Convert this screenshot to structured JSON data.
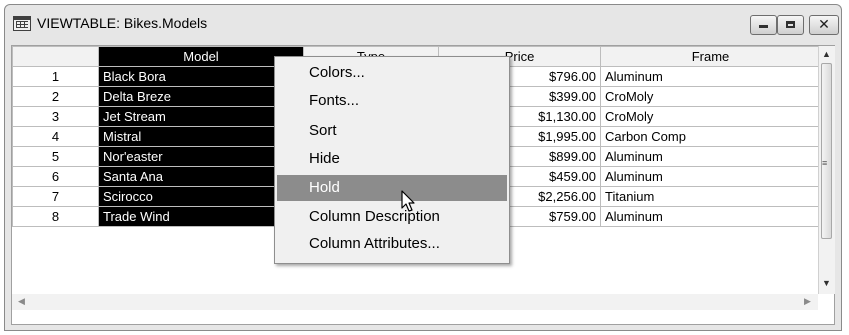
{
  "window": {
    "title": "VIEWTABLE: Bikes.Models",
    "controls": {
      "minimize": "minimize",
      "maximize": "maximize",
      "close": "✕"
    }
  },
  "table": {
    "columns": [
      "",
      "Model",
      "Type",
      "Price",
      "Frame"
    ],
    "rows": [
      {
        "n": "1",
        "model": "Black Bora",
        "price": "$796.00",
        "frame": "Aluminum"
      },
      {
        "n": "2",
        "model": "Delta Breze",
        "price": "$399.00",
        "frame": "CroMoly"
      },
      {
        "n": "3",
        "model": "Jet Stream",
        "price": "$1,130.00",
        "frame": "CroMoly"
      },
      {
        "n": "4",
        "model": "Mistral",
        "price": "$1,995.00",
        "frame": "Carbon Comp"
      },
      {
        "n": "5",
        "model": "Nor'easter",
        "price": "$899.00",
        "frame": "Aluminum"
      },
      {
        "n": "6",
        "model": "Santa Ana",
        "price": "$459.00",
        "frame": "Aluminum"
      },
      {
        "n": "7",
        "model": "Scirocco",
        "price": "$2,256.00",
        "frame": "Titanium"
      },
      {
        "n": "8",
        "model": "Trade Wind",
        "price": "$759.00",
        "frame": "Aluminum"
      }
    ]
  },
  "context_menu": {
    "items": [
      "Colors...",
      "Fonts...",
      "Sort",
      "Hide",
      "Hold",
      "Column Description",
      "Column Attributes..."
    ],
    "highlighted": "Hold"
  },
  "scrollbars": {
    "up_arrow": "▲",
    "down_arrow": "▼",
    "left_arrow": "◀",
    "right_arrow": "▶",
    "grip": "≡"
  },
  "colors": {
    "selection": "#000000",
    "menu_highlight": "#8c8c8c",
    "window_frame": "#e6e6e6"
  }
}
